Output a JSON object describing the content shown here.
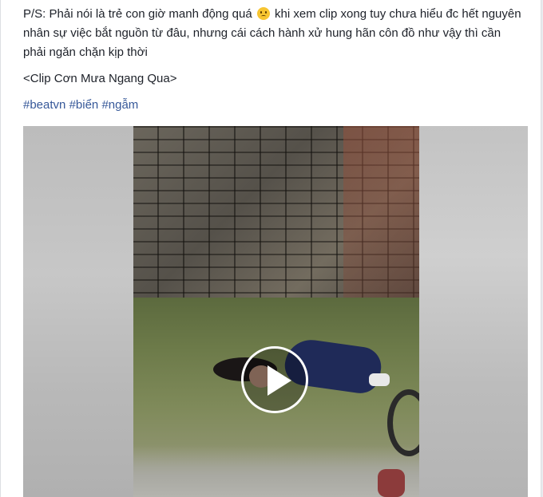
{
  "post": {
    "caption_line_1": "P/S: Phải nói là trẻ con giờ manh động quá",
    "caption_line_1_after_emoji": " khi xem clip xong tuy chưa hiểu đc hết nguyên nhân sự việc bắt nguồn từ đâu, nhưng cái cách hành xử hung hãn côn đồ như vậy thì cần phải ngăn chặn kịp thời",
    "emoji_icon": "worried-face-icon",
    "credit": "<Clip Cơn Mưa Ngang Qua>",
    "hashtags": [
      "#beatvn",
      "#biển",
      "#ngẫm"
    ]
  },
  "video": {
    "play_icon": "play-icon",
    "colors": {
      "overlay_ring": "#ffffff",
      "link": "#365899",
      "text": "#1d2129"
    }
  }
}
